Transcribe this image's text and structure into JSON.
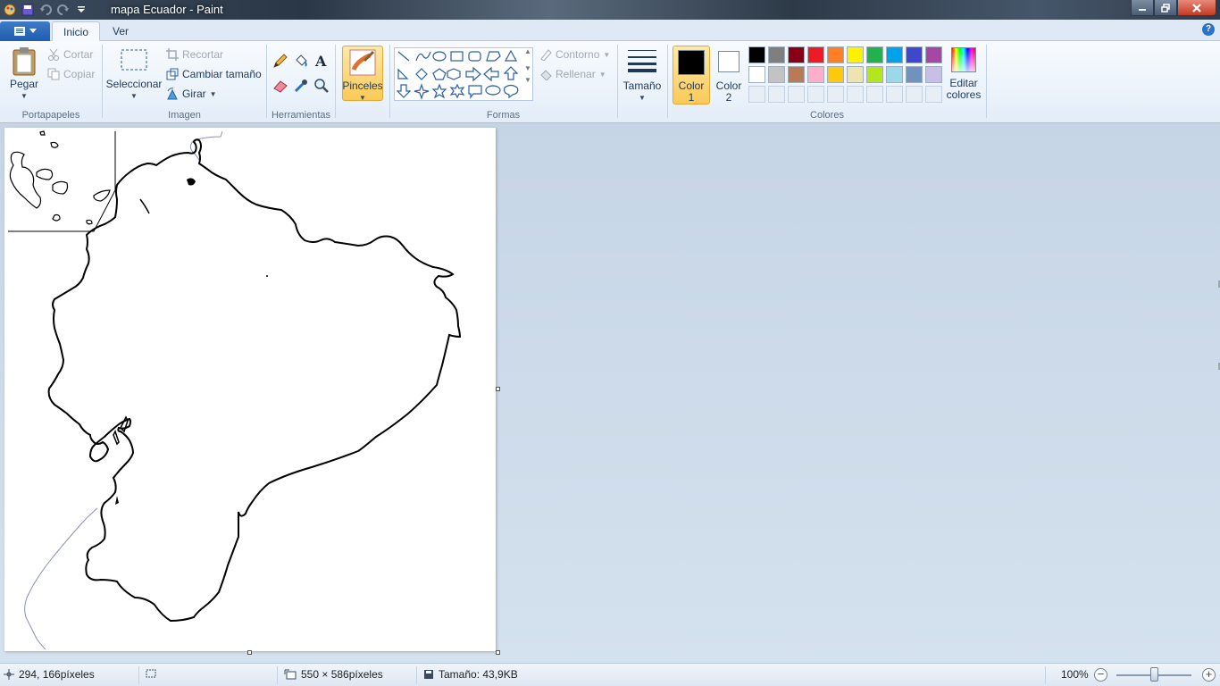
{
  "window": {
    "title": "mapa Ecuador - Paint",
    "minimize_icon": "minimize-icon",
    "maximize_icon": "restore-icon",
    "close_icon": "close-icon"
  },
  "tabs": {
    "inicio": "Inicio",
    "ver": "Ver"
  },
  "help_icon": "?",
  "ribbon": {
    "portapapeles": {
      "label": "Portapapeles",
      "paste": "Pegar",
      "cut": "Cortar",
      "copy": "Copiar"
    },
    "imagen": {
      "label": "Imagen",
      "select": "Seleccionar",
      "crop": "Recortar",
      "resize": "Cambiar tamaño",
      "rotate": "Girar"
    },
    "herramientas": {
      "label": "Herramientas"
    },
    "pinceles": "Pinceles",
    "formas": {
      "label": "Formas",
      "outline": "Contorno",
      "fill": "Rellenar"
    },
    "tamano": "Tamaño",
    "colores": {
      "label": "Colores",
      "color1_a": "Color",
      "color1_b": "1",
      "color2_a": "Color",
      "color2_b": "2",
      "edit_a": "Editar",
      "edit_b": "colores",
      "color1_value": "#000000",
      "color2_value": "#ffffff",
      "palette_row1": [
        "#000000",
        "#7f7f7f",
        "#880015",
        "#ed1c24",
        "#ff7f27",
        "#fff200",
        "#22b14c",
        "#00a2e8",
        "#3f48cc",
        "#a349a4"
      ],
      "palette_row2": [
        "#ffffff",
        "#c3c3c3",
        "#b97a57",
        "#ffaec9",
        "#ffc90e",
        "#efe4b0",
        "#b5e61d",
        "#99d9ea",
        "#7092be",
        "#c8bfe7"
      ],
      "palette_row3_count_label": ""
    }
  },
  "status": {
    "cursor_pos": "294, 166píxeles",
    "canvas_size": "550 × 586píxeles",
    "file_size": "Tamaño: 43,9KB",
    "zoom": "100%"
  }
}
